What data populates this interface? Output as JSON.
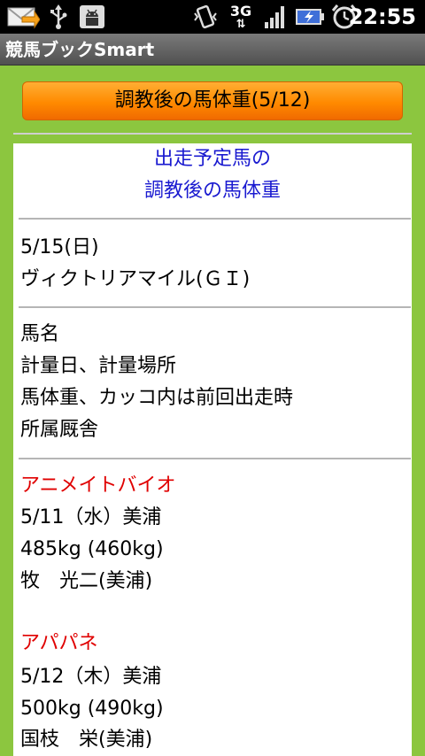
{
  "status": {
    "network": "3G",
    "time": "22:55"
  },
  "app": {
    "title": "競馬ブックSmart"
  },
  "header_button": {
    "label": "調教後の馬体重(5/12)"
  },
  "intro": {
    "line1": "出走予定馬の",
    "line2": "調教後の馬体重"
  },
  "race": {
    "date": "5/15(日)",
    "name": "ヴィクトリアマイル(ＧＩ)"
  },
  "legend": {
    "line1": "馬名",
    "line2": "計量日、計量場所",
    "line3": "馬体重、カッコ内は前回出走時",
    "line4": "所属厩舎"
  },
  "horses": [
    {
      "name": "アニメイトバイオ",
      "weigh": "5/11（水）美浦",
      "weight": "485kg (460kg)",
      "stable": "牧　光二(美浦)"
    },
    {
      "name": "アパパネ",
      "weigh": "5/12（木）美浦",
      "weight": "500kg (490kg)",
      "stable": "国枝　栄(美浦)"
    }
  ],
  "colors": {
    "accent_green": "#8cc63f",
    "button_orange": "#ff8a00",
    "horse_name_red": "#e00000",
    "intro_blue": "#1a1ad0"
  }
}
